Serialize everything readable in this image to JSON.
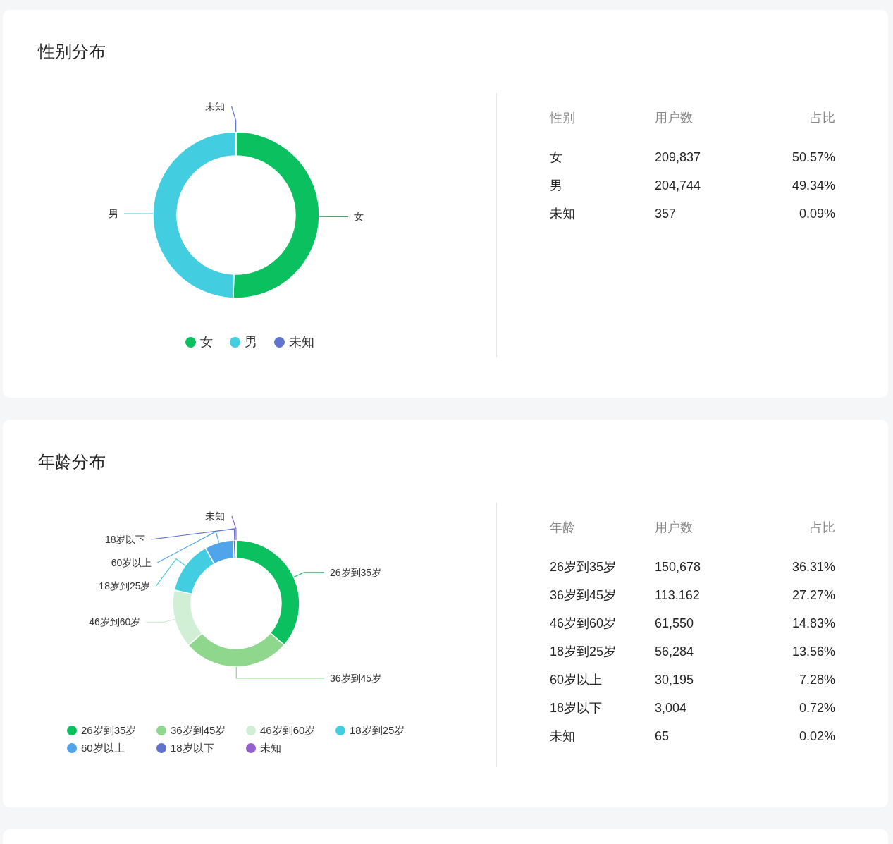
{
  "sections": [
    {
      "title": "性别分布",
      "chart_data": {
        "type": "donut",
        "categories": [
          "女",
          "男",
          "未知"
        ],
        "values": [
          50.57,
          49.34,
          0.09
        ]
      },
      "legend": [
        {
          "label": "女",
          "color": "#0ac05f"
        },
        {
          "label": "男",
          "color": "#42cde0"
        },
        {
          "label": "未知",
          "color": "#5f73cf"
        }
      ],
      "table": {
        "columns": [
          "性别",
          "用户数",
          "占比"
        ],
        "rows": [
          [
            "女",
            "209,837",
            "50.57%"
          ],
          [
            "男",
            "204,744",
            "49.34%"
          ],
          [
            "未知",
            "357",
            "0.09%"
          ]
        ]
      }
    },
    {
      "title": "年龄分布",
      "chart_data": {
        "type": "donut",
        "categories": [
          "26岁到35岁",
          "36岁到45岁",
          "46岁到60岁",
          "18岁到25岁",
          "60岁以上",
          "18岁以下",
          "未知"
        ],
        "values": [
          36.31,
          27.27,
          14.83,
          13.56,
          7.28,
          0.72,
          0.02
        ]
      },
      "legend": [
        {
          "label": "26岁到35岁",
          "color": "#0ac05f"
        },
        {
          "label": "36岁到45岁",
          "color": "#90d78e"
        },
        {
          "label": "46岁到60岁",
          "color": "#d0efd4"
        },
        {
          "label": "18岁到25岁",
          "color": "#42cde0"
        },
        {
          "label": "60岁以上",
          "color": "#4fa4ea"
        },
        {
          "label": "18岁以下",
          "color": "#5f73cf"
        },
        {
          "label": "未知",
          "color": "#9361cf"
        }
      ],
      "table": {
        "columns": [
          "年龄",
          "用户数",
          "占比"
        ],
        "rows": [
          [
            "26岁到35岁",
            "150,678",
            "36.31%"
          ],
          [
            "36岁到45岁",
            "113,162",
            "27.27%"
          ],
          [
            "46岁到60岁",
            "61,550",
            "14.83%"
          ],
          [
            "18岁到25岁",
            "56,284",
            "13.56%"
          ],
          [
            "60岁以上",
            "30,195",
            "7.28%"
          ],
          [
            "18岁以下",
            "3,004",
            "0.72%"
          ],
          [
            "未知",
            "65",
            "0.02%"
          ]
        ]
      }
    }
  ]
}
